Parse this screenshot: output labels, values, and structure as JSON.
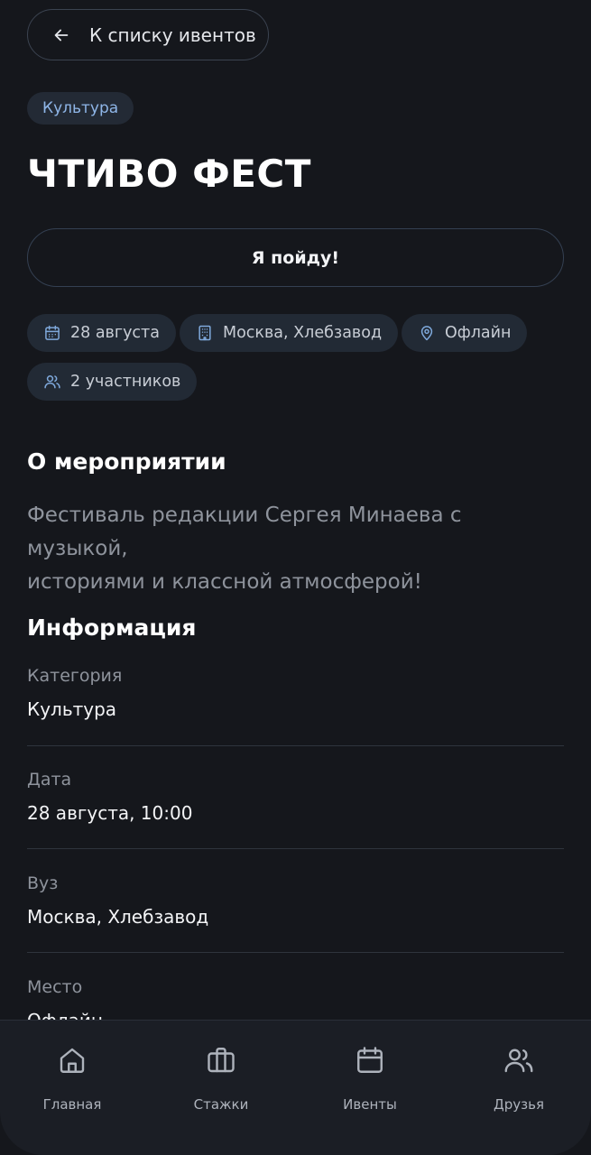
{
  "header": {
    "back_label": "К списку ивентов"
  },
  "event": {
    "category_chip": "Культура",
    "title": "ЧТИВО ФЕСТ",
    "join_button": "Я пойду!",
    "tags": {
      "date": "28 августа",
      "venue": "Москва, Хлебзавод",
      "format": "Офлайн",
      "participants": "2 участников"
    }
  },
  "about": {
    "heading": "О мероприятии",
    "line1": "Фестиваль редакции Сергея Минаева с музыкой,",
    "line2": "историями и классной атмосферой!"
  },
  "info": {
    "heading": "Информация",
    "rows": [
      {
        "label": "Категория",
        "value": "Культура"
      },
      {
        "label": "Дата",
        "value": "28 августа, 10:00"
      },
      {
        "label": "Вуз",
        "value": "Москва, Хлебзавод"
      },
      {
        "label": "Место",
        "value": "Офлайн"
      }
    ]
  },
  "tabbar": {
    "items": [
      {
        "label": "Главная",
        "icon": "home-icon"
      },
      {
        "label": "Стажки",
        "icon": "briefcase-icon"
      },
      {
        "label": "Ивенты",
        "icon": "calendar-icon"
      },
      {
        "label": "Друзья",
        "icon": "users-icon"
      }
    ]
  },
  "colors": {
    "background": "#15171c",
    "chip_background": "#222a35",
    "accent_icon": "#7fa9dc",
    "chip_text": "#8fb6e8"
  }
}
